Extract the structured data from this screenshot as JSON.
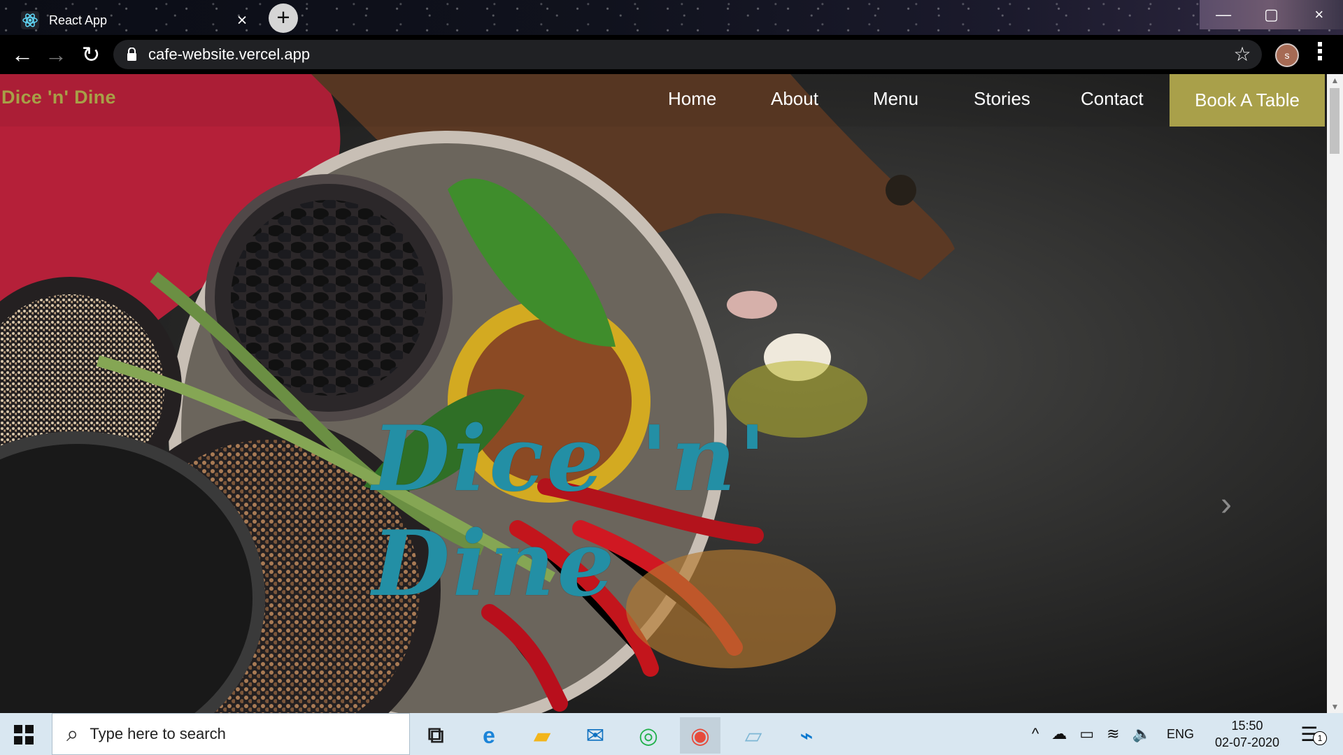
{
  "browser": {
    "tab": {
      "title": "React App",
      "close_label": "×",
      "icon": "react-icon"
    },
    "new_tab_label": "+",
    "window_controls": {
      "minimize": "—",
      "maximize": "▢",
      "close": "×"
    },
    "toolbar": {
      "back_label": "←",
      "forward_label": "→",
      "reload_label": "↻",
      "url": "cafe-website.vercel.app",
      "star_label": "☆",
      "profile_initial": "s",
      "menu_label": "⋮"
    }
  },
  "website": {
    "brand": "Dice 'n' Dine",
    "nav_items": [
      "Home",
      "About",
      "Menu",
      "Stories",
      "Contact"
    ],
    "book_button": "Book A Table",
    "hero_title": "Dice 'n' Dine",
    "carousel_next_label": "›",
    "colors": {
      "brand": "#a7a047",
      "book_button": "#a9a04a",
      "hero_title": "#238fa5"
    }
  },
  "scrollbar": {
    "up_label": "▲",
    "down_label": "▼"
  },
  "taskbar": {
    "search_placeholder": "Type here to search",
    "search_icon_label": "⌕",
    "apps": [
      {
        "name": "task-view",
        "label": "⧉"
      },
      {
        "name": "edge",
        "label": "e"
      },
      {
        "name": "file-explorer",
        "label": "▰"
      },
      {
        "name": "mail",
        "label": "✉"
      },
      {
        "name": "whatsapp",
        "label": "◎"
      },
      {
        "name": "chrome",
        "label": "◉"
      },
      {
        "name": "notepad",
        "label": "▱"
      },
      {
        "name": "vscode",
        "label": "⌁"
      }
    ],
    "tray": {
      "chevron": "^",
      "cloud": "☁",
      "battery": "▭",
      "wifi": "≋",
      "volume": "🔈",
      "language": "ENG",
      "time": "15:50",
      "date": "02-07-2020",
      "notification_icon": "☰",
      "notification_count": "1"
    }
  }
}
